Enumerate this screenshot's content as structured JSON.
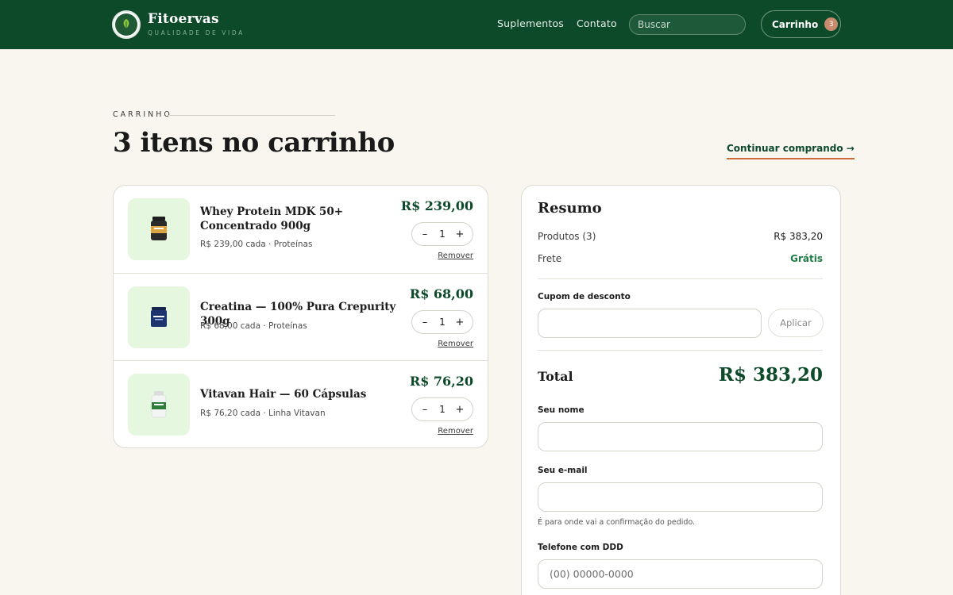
{
  "header": {
    "brand_name": "Fitoervas",
    "brand_tagline": "QUALIDADE DE VIDA",
    "logo_text": "FITOERVAS",
    "nav": [
      {
        "label": "Suplementos"
      },
      {
        "label": "Contato"
      }
    ],
    "search_placeholder": "Buscar",
    "cart_label": "Carrinho",
    "cart_count": "3"
  },
  "page": {
    "eyebrow": "CARRINHO",
    "title": "3 itens no carrinho",
    "continue_label": "Continuar comprando →"
  },
  "items": [
    {
      "name": "Whey Protein MDK 50+ Concentrado 900g",
      "meta": "R$ 239,00 cada · Proteínas",
      "price": "R$ 239,00",
      "qty": "1",
      "minus": "–",
      "plus": "+",
      "remove": "Remover",
      "icon": "whey-jar-icon"
    },
    {
      "name": "Creatina — 100% Pura Crepurity 300g",
      "meta": "R$ 68,00 cada · Proteínas",
      "price": "R$ 68,00",
      "qty": "1",
      "minus": "–",
      "plus": "+",
      "remove": "Remover",
      "icon": "creatine-tub-icon"
    },
    {
      "name": "Vitavan Hair — 60 Cápsulas",
      "meta": "R$ 76,20 cada · Linha Vitavan",
      "price": "R$ 76,20",
      "qty": "1",
      "minus": "–",
      "plus": "+",
      "remove": "Remover",
      "icon": "capsule-bottle-icon"
    }
  ],
  "summary": {
    "title": "Resumo",
    "products_label": "Produtos (3)",
    "products_value": "R$ 383,20",
    "shipping_label": "Frete",
    "shipping_value": "Grátis",
    "coupon_label": "Cupom de desconto",
    "coupon_value": "",
    "apply_label": "Aplicar",
    "total_label": "Total",
    "total_value": "R$ 383,20",
    "name_label": "Seu nome",
    "name_value": "",
    "email_label": "Seu e-mail",
    "email_value": "",
    "email_hint": "É para onde vai a confirmação do pedido.",
    "phone_label": "Telefone com DDD",
    "phone_placeholder": "(00) 00000-0000"
  },
  "colors": {
    "header_bg": "#0d4a2a",
    "accent_green": "#0d4a2a",
    "link_underline": "#c9693c",
    "badge": "#c98b6d",
    "free_shipping": "#1f7a45",
    "page_bg": "#f8f6ee",
    "thumb_bg": "#e6f7df"
  }
}
